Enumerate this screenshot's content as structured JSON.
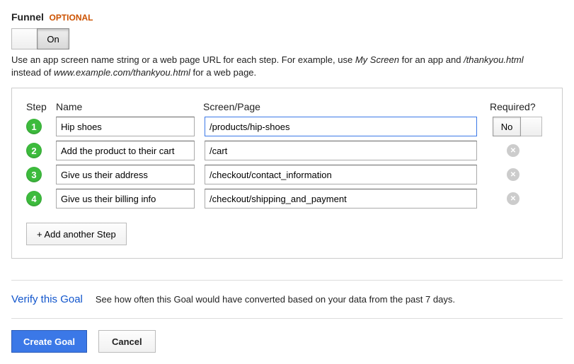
{
  "funnel": {
    "title": "Funnel",
    "optional": "OPTIONAL",
    "toggle": {
      "on": "On"
    },
    "help_pre": "Use an app screen name string or a web page URL for each step. For example, use ",
    "help_ex1": "My Screen",
    "help_mid": " for an app and ",
    "help_ex2": "/thankyou.html",
    "help_mid2": " instead of ",
    "help_ex3": "www.example.com/thankyou.html",
    "help_post": " for a web page."
  },
  "headers": {
    "step": "Step",
    "name": "Name",
    "screen": "Screen/Page",
    "required": "Required?"
  },
  "steps": [
    {
      "n": "1",
      "name": "Hip shoes",
      "screen": "/products/hip-shoes",
      "focused": true,
      "required_label": "No"
    },
    {
      "n": "2",
      "name": "Add the product to their cart",
      "screen": "/cart"
    },
    {
      "n": "3",
      "name": "Give us their address",
      "screen": "/checkout/contact_information"
    },
    {
      "n": "4",
      "name": "Give us their billing info",
      "screen": "/checkout/shipping_and_payment"
    }
  ],
  "add_step_label": "+ Add another Step",
  "verify": {
    "link": "Verify this Goal",
    "desc": "See how often this Goal would have converted based on your data from the past 7 days."
  },
  "actions": {
    "create": "Create Goal",
    "cancel": "Cancel"
  }
}
